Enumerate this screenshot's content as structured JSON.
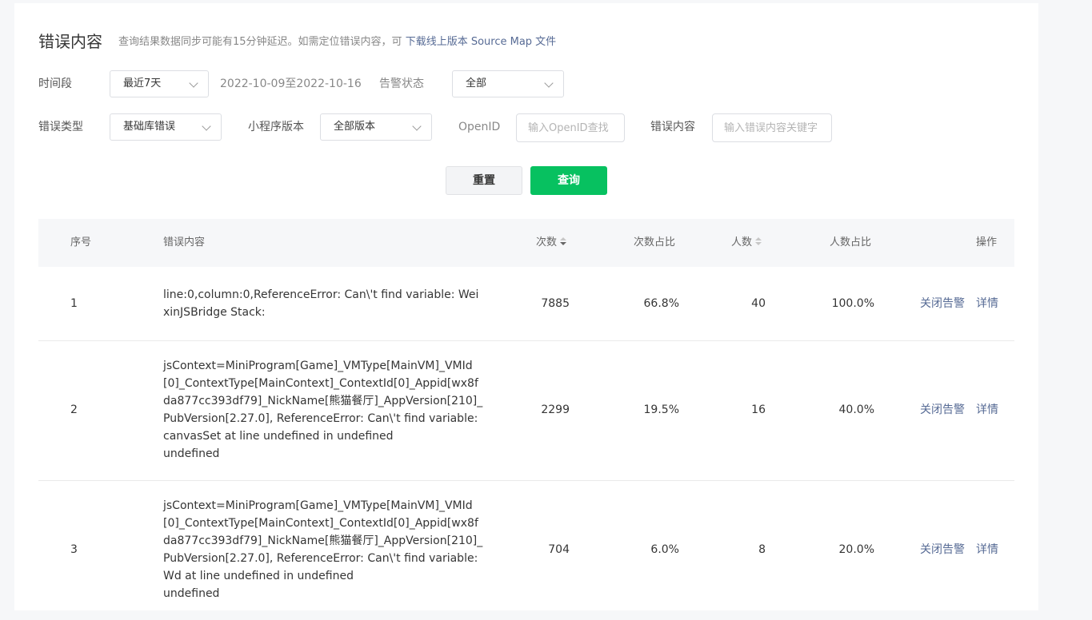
{
  "header": {
    "title": "错误内容",
    "note": "查询结果数据同步可能有15分钟延迟。如需定位错误内容，可",
    "link": "下载线上版本 Source Map 文件"
  },
  "filters": {
    "time_label": "时间段",
    "time_value": "最近7天",
    "date_range": "2022-10-09至2022-10-16",
    "alert_label": "告警状态",
    "alert_value": "全部",
    "errtype_label": "错误类型",
    "errtype_value": "基础库错误",
    "version_label": "小程序版本",
    "version_value": "全部版本",
    "openid_label": "OpenID",
    "openid_placeholder": "输入OpenID查找",
    "content_label": "错误内容",
    "content_placeholder": "输入错误内容关键字"
  },
  "buttons": {
    "reset": "重置",
    "query": "查询"
  },
  "table": {
    "columns": {
      "index": "序号",
      "content": "错误内容",
      "count": "次数",
      "count_ratio": "次数占比",
      "users": "人数",
      "users_ratio": "人数占比",
      "action": "操作"
    },
    "rows": [
      {
        "index": "1",
        "content": "line:0,column:0,ReferenceError: Can\\'t find variable: WeixinJSBridge Stack:",
        "count": "7885",
        "count_ratio": "66.8%",
        "users": "40",
        "users_ratio": "100.0%",
        "close": "关闭告警",
        "detail": "详情"
      },
      {
        "index": "2",
        "content": "jsContext=MiniProgram[Game]_VMType[MainVM]_VMId[0]_ContextType[MainContext]_ContextId[0]_Appid[wx8fda877cc393df79]_NickName[熊猫餐厅]_AppVersion[210]_PubVersion[2.27.0], ReferenceError: Can\\'t find variable: canvasSet at line undefined in undefined\nundefined",
        "count": "2299",
        "count_ratio": "19.5%",
        "users": "16",
        "users_ratio": "40.0%",
        "close": "关闭告警",
        "detail": "详情"
      },
      {
        "index": "3",
        "content": "jsContext=MiniProgram[Game]_VMType[MainVM]_VMId[0]_ContextType[MainContext]_ContextId[0]_Appid[wx8fda877cc393df79]_NickName[熊猫餐厅]_AppVersion[210]_PubVersion[2.27.0], ReferenceError: Can\\'t find variable: Wd at line undefined in undefined\nundefined",
        "count": "704",
        "count_ratio": "6.0%",
        "users": "8",
        "users_ratio": "20.0%",
        "close": "关闭告警",
        "detail": "详情"
      }
    ]
  }
}
